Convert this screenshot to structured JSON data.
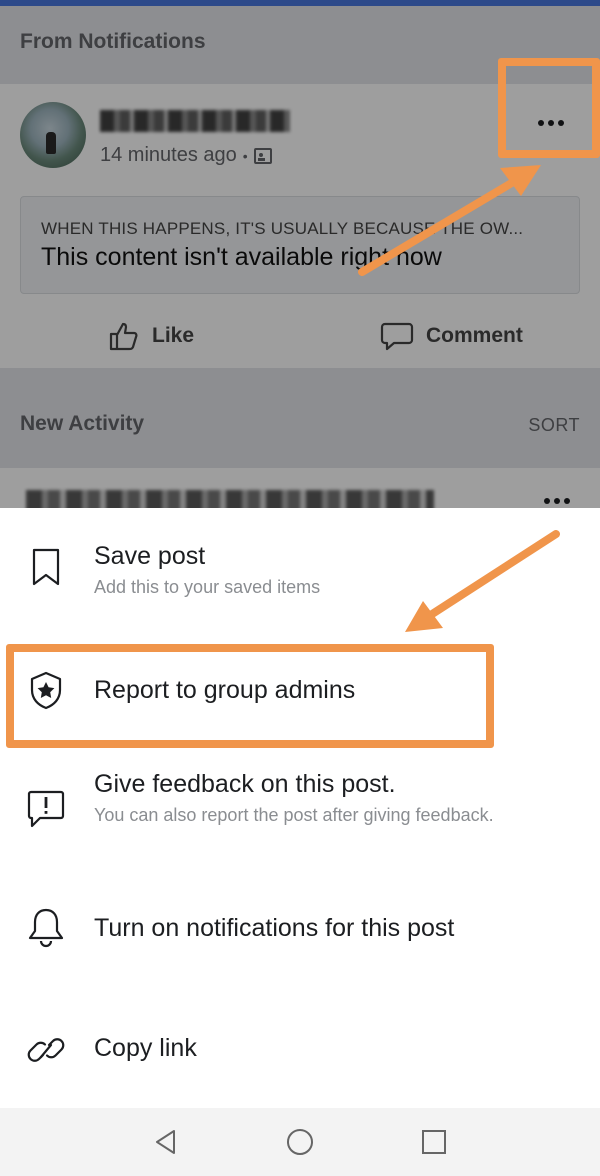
{
  "feed": {
    "section_notifications": "From Notifications",
    "post": {
      "time": "14 minutes ago",
      "unavailable_caption": "WHEN THIS HAPPENS, IT'S USUALLY BECAUSE THE OW...",
      "unavailable_message": "This content isn't available right now",
      "like_label": "Like",
      "comment_label": "Comment"
    },
    "section_activity": "New Activity",
    "sort_label": "SORT"
  },
  "sheet": {
    "items": [
      {
        "title": "Save post",
        "subtitle": "Add this to your saved items",
        "icon": "bookmark-icon"
      },
      {
        "title": "Report to group admins",
        "icon": "shield-star-icon"
      },
      {
        "title": "Give feedback on this post.",
        "subtitle": "You can also report the post after giving feedback.",
        "icon": "feedback-exclamation-icon"
      },
      {
        "title": "Turn on notifications for this post",
        "icon": "bell-icon"
      },
      {
        "title": "Copy link",
        "icon": "link-icon"
      }
    ]
  },
  "colors": {
    "highlight": "#f0954b",
    "brand": "#2d4a8a"
  }
}
